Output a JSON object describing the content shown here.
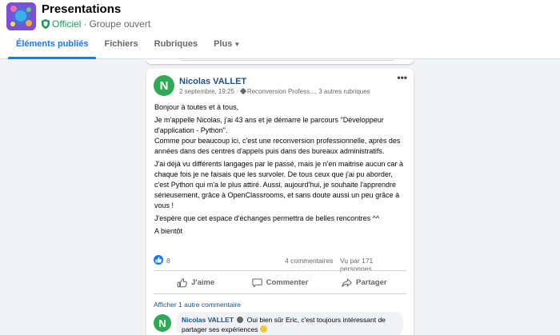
{
  "group": {
    "title": "Presentations",
    "official_label": "Officiel",
    "separator": "·",
    "type_label": "Groupe ouvert"
  },
  "tabs": [
    {
      "label": "Éléments publiés",
      "active": true
    },
    {
      "label": "Fichiers",
      "active": false
    },
    {
      "label": "Rubriques",
      "active": false
    },
    {
      "label": "Plus",
      "active": false
    }
  ],
  "post": {
    "avatar_letter": "N",
    "author": "Nicolas VALLET",
    "date": "2 septembre, 19:25 ·",
    "topics": "Reconversion Profess..., 3 autres rubriques",
    "more": "•••",
    "paragraphs": [
      "Bonjour à toutes et à tous,",
      "Je m'appelle Nicolas, j'ai 43 ans et je démarre le parcours \"Développeur d'application - Python\".",
      "Comme pour beaucoup ici, c'est une reconversion professionnelle, après des années dans des centres d'appels puis dans des bureaux administratifs.",
      "J'ai déjà vu différents langages par le passé, mais je n'en maitrise aucun car à chaque fois je ne faisais que les survoler. De tous ceux que j'ai pu aborder, c'est Python qui m'a le plus attiré. Aussi, aujourd'hui, je souhaite l'apprendre sérieusement, grâce à OpenClassrooms, et sans doute aussi un peu grâce à vous !",
      "J'espère que cet espace d'échanges permettra de belles rencontres ^^",
      "A bientôt"
    ],
    "like_count": "8",
    "comments_count": "4 commentaires",
    "views_count": "Vu par 171 personnes",
    "actions": {
      "like": "J'aime",
      "comment": "Commenter",
      "share": "Partager"
    },
    "show_more_comments": "Afficher 1 autre commentaire",
    "comment": {
      "avatar_letter": "N",
      "author": "Nicolas VALLET",
      "text_line1": "Oui bien sûr Eric, c'est toujours intéressant de",
      "text_line2": "partager ses expériences"
    }
  },
  "colors": {
    "accent": "#1877f2",
    "official": "#1a9a57",
    "avatar_green": "#2eaa57",
    "link": "#1b4f8a"
  }
}
